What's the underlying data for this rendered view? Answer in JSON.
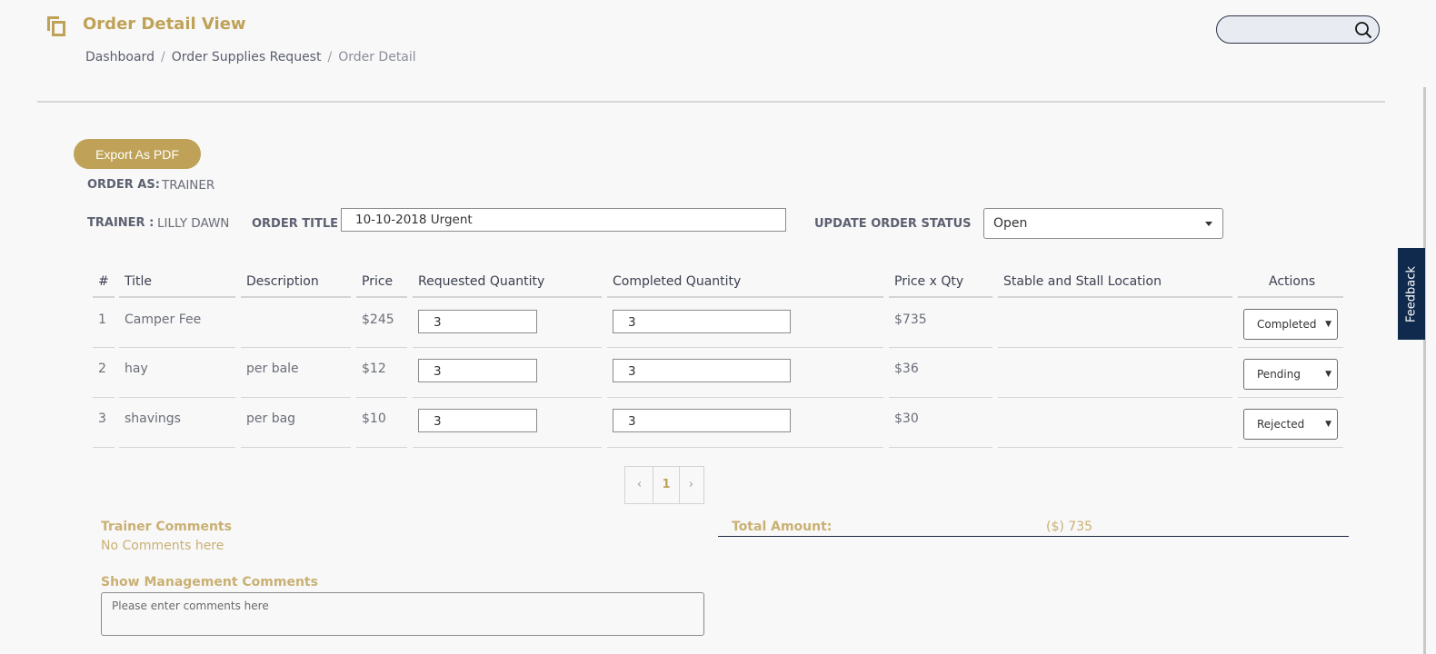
{
  "header": {
    "title": "Order Detail View",
    "breadcrumb": [
      "Dashboard",
      "Order Supplies Request",
      "Order Detail"
    ],
    "search_placeholder": ""
  },
  "toolbar": {
    "export_label": "Export As PDF"
  },
  "order": {
    "order_as_label": "ORDER AS:",
    "order_as_value": "TRAINER",
    "trainer_label": "TRAINER :",
    "trainer_value": "LILLY DAWN",
    "title_label": "ORDER TITLE",
    "title_value": "10-10-2018 Urgent",
    "status_label": "UPDATE ORDER STATUS",
    "status_value": "Open"
  },
  "table": {
    "headers": [
      "#",
      "Title",
      "Description",
      "Price",
      "Requested Quantity",
      "Completed Quantity",
      "Price x Qty",
      "Stable and Stall Location",
      "Actions"
    ],
    "rows": [
      {
        "num": "1",
        "title": "Camper Fee",
        "description": "",
        "price": "$245",
        "requested": "3",
        "completed": "3",
        "total": "$735",
        "location": "",
        "action": "Completed"
      },
      {
        "num": "2",
        "title": "hay",
        "description": "per bale",
        "price": "$12",
        "requested": "3",
        "completed": "3",
        "total": "$36",
        "location": "",
        "action": "Pending"
      },
      {
        "num": "3",
        "title": "shavings",
        "description": "per bag",
        "price": "$10",
        "requested": "3",
        "completed": "3",
        "total": "$30",
        "location": "",
        "action": "Rejected"
      }
    ]
  },
  "pagination": {
    "prev": "‹",
    "current": "1",
    "next": "›"
  },
  "comments": {
    "trainer_label": "Trainer Comments",
    "trainer_value": "No Comments here",
    "management_label": "Show Management Comments",
    "management_placeholder": "Please enter comments here"
  },
  "totals": {
    "label": "Total Amount:",
    "value": "($) 735"
  },
  "feedback_label": "Feedback",
  "colors": {
    "accent": "#bfa257",
    "feedback_bg": "#0f2a4d"
  }
}
